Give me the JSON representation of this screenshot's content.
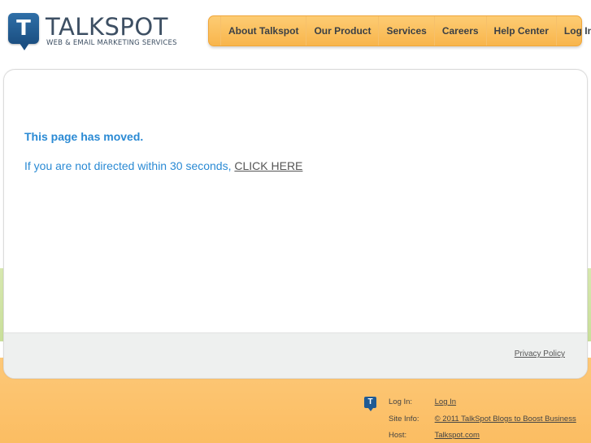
{
  "header": {
    "logo_mark": "T",
    "logo_name": "TALKSPOT",
    "logo_tagline": "WEB & EMAIL MARKETING SERVICES"
  },
  "nav": {
    "items": [
      {
        "label": "About Talkspot"
      },
      {
        "label": "Our Product"
      },
      {
        "label": "Services"
      },
      {
        "label": "Careers"
      },
      {
        "label": "Help Center"
      },
      {
        "label": "Log In"
      }
    ]
  },
  "main": {
    "title": "This page has moved.",
    "redirect_text": "If you are not directed within 30 seconds, ",
    "redirect_link": "CLICK HERE"
  },
  "panel_footer": {
    "privacy_link": "Privacy Policy"
  },
  "site_footer": {
    "icon": "T",
    "rows": [
      {
        "label": "Log In:",
        "value": "Log In"
      },
      {
        "label": "Site Info:",
        "value": "© 2011 TalkSpot Blogs to Boost Business"
      },
      {
        "label": "Host:",
        "value": "Talkspot.com"
      }
    ]
  },
  "colors": {
    "accent_blue": "#2a8ad4",
    "nav_orange": "#f8b54c",
    "footer_orange": "#fbbd62",
    "band_green": "#c9df9a"
  }
}
